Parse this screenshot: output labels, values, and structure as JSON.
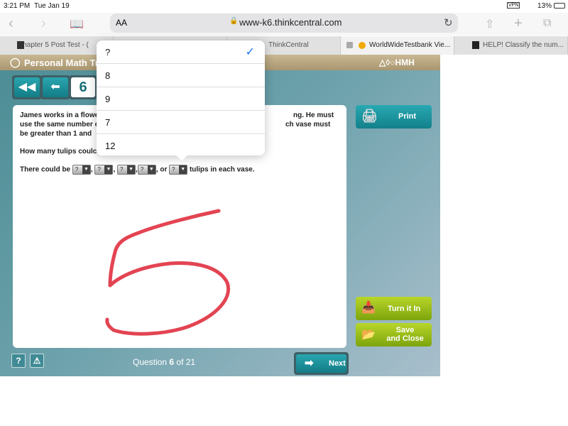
{
  "status": {
    "time": "3:21 PM",
    "date": "Tue Jan 19",
    "battery": "13%",
    "vpn": "VPN"
  },
  "browser": {
    "text_size": "AA",
    "url": "www-k6.thinkcentral.com",
    "tabs": [
      {
        "label": "Chapter 5 Post Test - ("
      },
      {
        "label": ""
      },
      {
        "label": "ThinkCentral"
      },
      {
        "label": "WorldWideTestbank Vie..."
      },
      {
        "label": "HELP! Classify the num..."
      }
    ]
  },
  "app": {
    "title": "Personal Math Tr",
    "brand": "HMH",
    "question_number": "6",
    "question": {
      "line1_a": "James works in a flowe",
      "line1_b": "ng. He must",
      "line2_a": "use the same number o",
      "line2_b": "ch vase must",
      "line3_a": "be greater than 1 and",
      "prompt": "How many tulips coulc",
      "answer_prefix": "There could be",
      "answer_suffix": "tulips in each vase.",
      "sep1": ",",
      "sep2": ",",
      "sep3": ",",
      "sep4": ", or",
      "blank": "?"
    },
    "print_label": "Print",
    "turn_in_label": "Turn it In",
    "save_close_line1": "Save",
    "save_close_line2": "and Close",
    "help_label": "?",
    "alert_label": "!",
    "progress_prefix": "Question",
    "progress_current": "6",
    "progress_of": "of 21",
    "next_label": "Next"
  },
  "dropdown": {
    "options": [
      "?",
      "8",
      "9",
      "7",
      "12"
    ],
    "selected": "?"
  },
  "colors": {
    "ink": "#e0303f",
    "teal": "#1a8c96",
    "green": "#9cc21d"
  }
}
